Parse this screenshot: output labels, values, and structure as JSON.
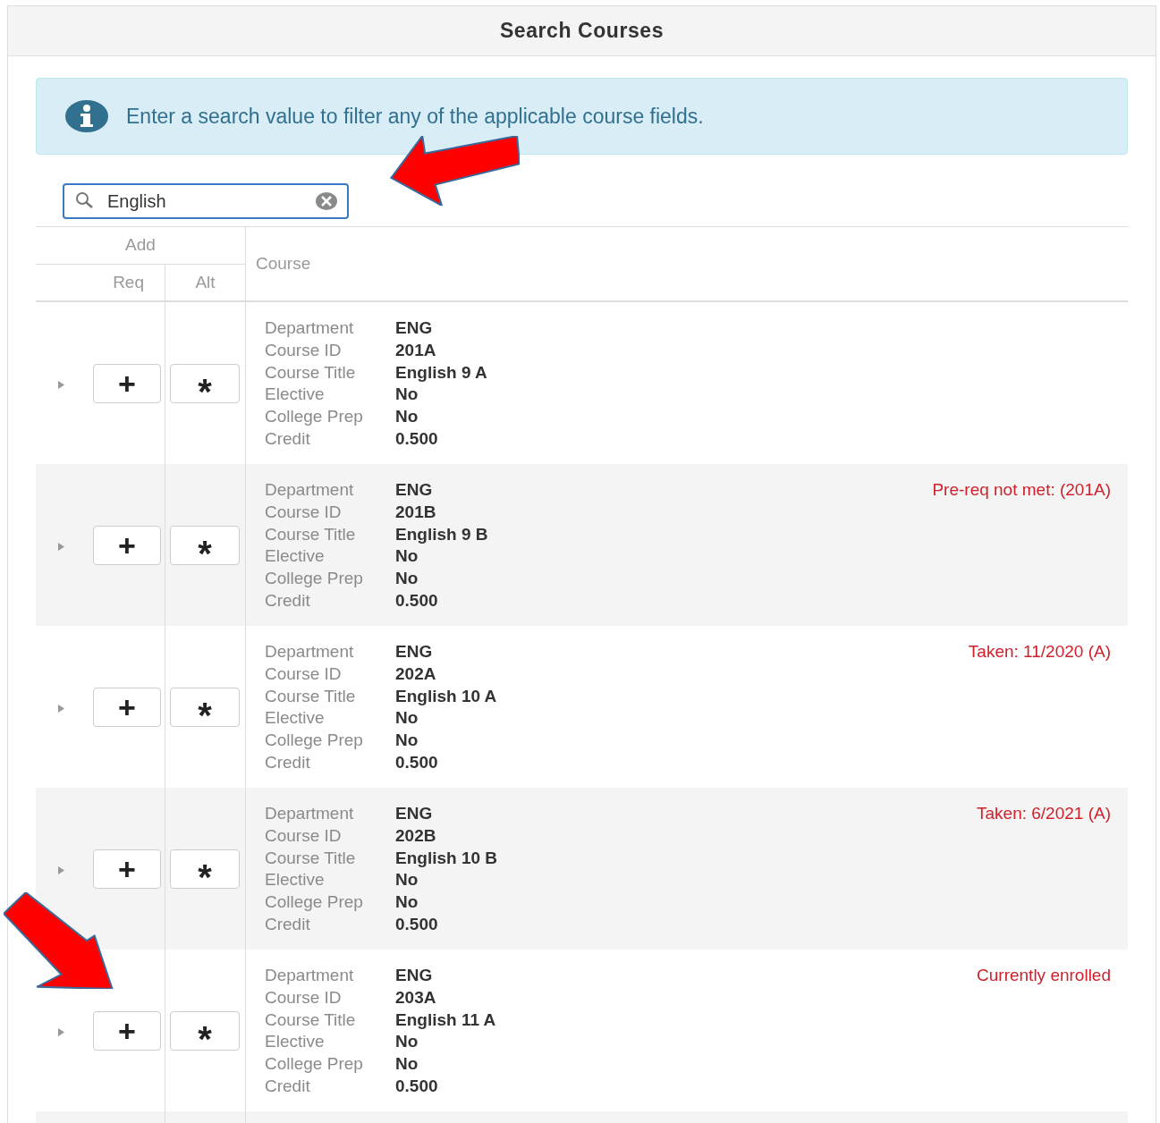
{
  "window": {
    "title": "Search Courses"
  },
  "info": {
    "text": "Enter a search value to filter any of the applicable course fields."
  },
  "search": {
    "value": "English"
  },
  "table": {
    "group_header": "Add",
    "columns": [
      "Req",
      "Alt",
      "Course"
    ],
    "rows": [
      {
        "add_req": "+",
        "add_alt": "*",
        "fields": [
          {
            "label": "Department",
            "value": "ENG"
          },
          {
            "label": "Course ID",
            "value": "201A"
          },
          {
            "label": "Course Title",
            "value": "English 9 A"
          },
          {
            "label": "Elective",
            "value": "No"
          },
          {
            "label": "College Prep",
            "value": "No"
          },
          {
            "label": "Credit",
            "value": "0.500"
          }
        ]
      },
      {
        "add_req": "+",
        "add_alt": "*",
        "note": "Pre-req not met: (201A)",
        "fields": [
          {
            "label": "Department",
            "value": "ENG"
          },
          {
            "label": "Course ID",
            "value": "201B"
          },
          {
            "label": "Course Title",
            "value": "English 9 B"
          },
          {
            "label": "Elective",
            "value": "No"
          },
          {
            "label": "College Prep",
            "value": "No"
          },
          {
            "label": "Credit",
            "value": "0.500"
          }
        ]
      },
      {
        "add_req": "+",
        "add_alt": "*",
        "note": "Taken: 11/2020 (A)",
        "fields": [
          {
            "label": "Department",
            "value": "ENG"
          },
          {
            "label": "Course ID",
            "value": "202A"
          },
          {
            "label": "Course Title",
            "value": "English 10 A"
          },
          {
            "label": "Elective",
            "value": "No"
          },
          {
            "label": "College Prep",
            "value": "No"
          },
          {
            "label": "Credit",
            "value": "0.500"
          }
        ]
      },
      {
        "add_req": "+",
        "add_alt": "*",
        "note": "Taken: 6/2021 (A)",
        "fields": [
          {
            "label": "Department",
            "value": "ENG"
          },
          {
            "label": "Course ID",
            "value": "202B"
          },
          {
            "label": "Course Title",
            "value": "English 10 B"
          },
          {
            "label": "Elective",
            "value": "No"
          },
          {
            "label": "College Prep",
            "value": "No"
          },
          {
            "label": "Credit",
            "value": "0.500"
          }
        ]
      },
      {
        "add_req": "+",
        "add_alt": "*",
        "note": "Currently enrolled",
        "fields": [
          {
            "label": "Department",
            "value": "ENG"
          },
          {
            "label": "Course ID",
            "value": "203A"
          },
          {
            "label": "Course Title",
            "value": "English 11 A"
          },
          {
            "label": "Elective",
            "value": "No"
          },
          {
            "label": "College Prep",
            "value": "No"
          },
          {
            "label": "Credit",
            "value": "0.500"
          }
        ]
      }
    ]
  }
}
